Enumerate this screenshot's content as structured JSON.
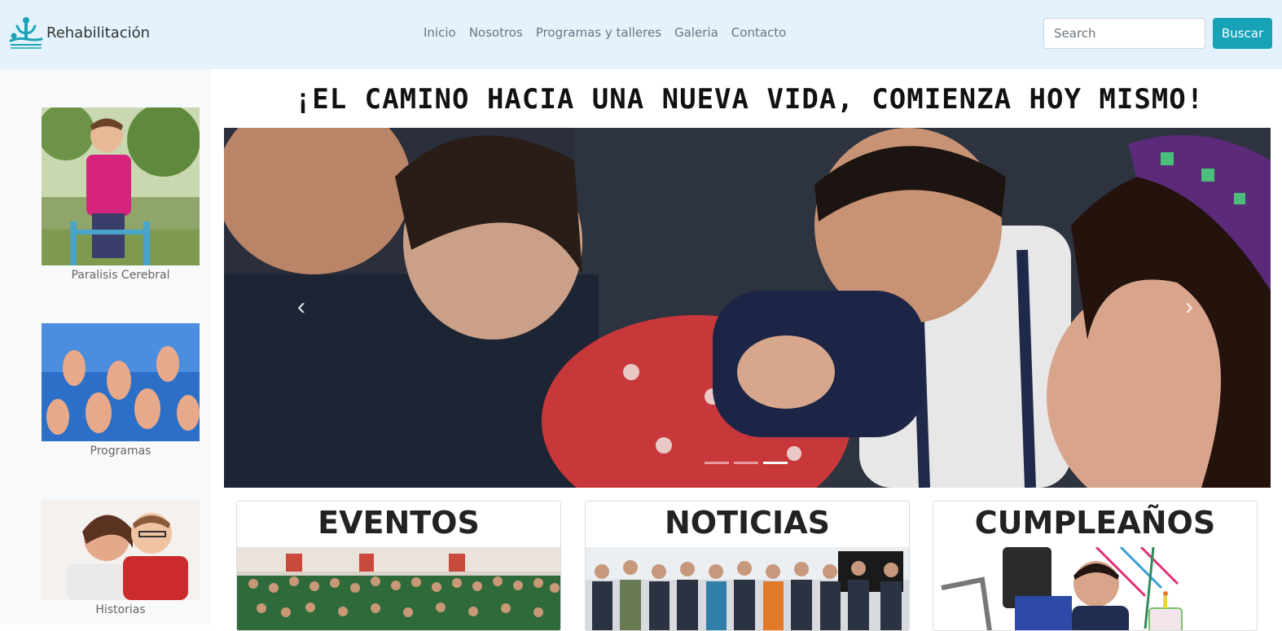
{
  "navbar": {
    "brand": "Rehabilitación",
    "links": [
      "Inicio",
      "Nosotros",
      "Programas y talleres",
      "Galeria",
      "Contacto"
    ],
    "search_placeholder": "Search",
    "search_button": "Buscar"
  },
  "sidebar": {
    "items": [
      {
        "caption": "Paralisis Cerebral"
      },
      {
        "caption": "Programas"
      },
      {
        "caption": "Historias"
      }
    ]
  },
  "main": {
    "headline": "¡EL CAMINO HACIA UNA NUEVA VIDA, COMIENZA HOY MISMO!",
    "carousel": {
      "prev_icon": "‹",
      "next_icon": "›",
      "slide_count": 3,
      "active_slide": 3
    },
    "cards": [
      {
        "title": "EVENTOS"
      },
      {
        "title": "NOTICIAS"
      },
      {
        "title": "CUMPLEAÑOS"
      }
    ]
  },
  "colors": {
    "navbar_bg": "#e3f2fd",
    "sidebar_bg": "#f8f9fa",
    "accent": "#17a2b8",
    "logo": "#1aa3b5"
  }
}
